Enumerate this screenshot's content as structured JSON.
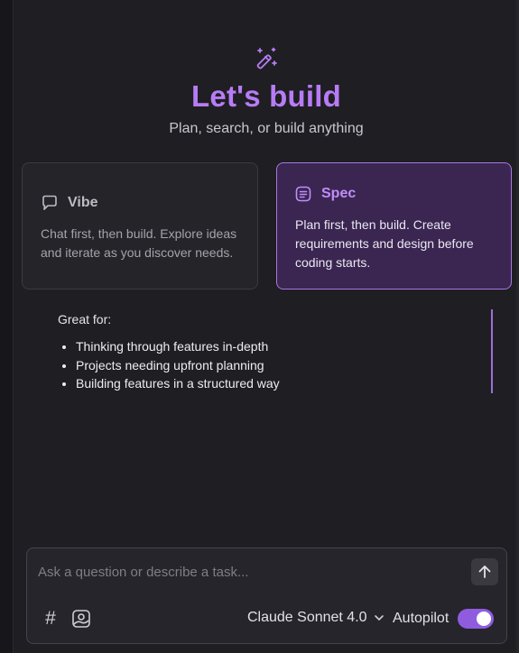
{
  "hero": {
    "title": "Let's build",
    "subtitle": "Plan, search, or build anything",
    "icon": "magic-wand-icon"
  },
  "modes": [
    {
      "name": "Vibe",
      "icon": "speech-bubble-icon",
      "description": "Chat first, then build. Explore ideas and iterate as you discover needs.",
      "selected": false
    },
    {
      "name": "Spec",
      "icon": "document-list-icon",
      "description": "Plan first, then build. Create requirements and design before coding starts.",
      "selected": true
    }
  ],
  "great_for": {
    "label": "Great for:",
    "items": [
      "Thinking through features in-depth",
      "Projects needing upfront planning",
      "Building features in a structured way"
    ]
  },
  "composer": {
    "placeholder": "Ask a question or describe a task...",
    "value": "",
    "model": "Claude Sonnet 4.0",
    "autopilot_label": "Autopilot",
    "autopilot_on": true
  },
  "colors": {
    "accent": "#b77cf5",
    "selected_card_bg": "#3a2650",
    "toggle_on": "#8f5ce0",
    "background": "#1f1e23"
  }
}
